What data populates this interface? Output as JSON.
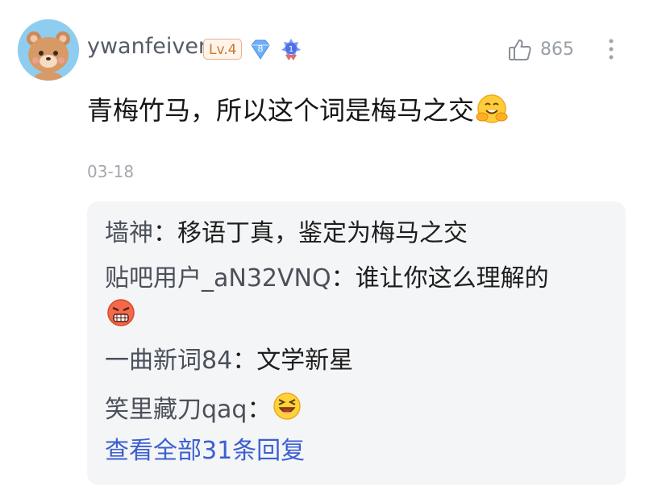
{
  "comment": {
    "username": "ywanfeiver",
    "level": "Lv.4",
    "gem_badge": "8",
    "medal_badge": "1",
    "like_count": "865",
    "text": "青梅竹马，所以这个词是梅马之交",
    "text_emoji": "hugging-face-emoji",
    "date": "03-18"
  },
  "replies": [
    {
      "user": "墙神",
      "sep": "：",
      "text": "移语丁真，鉴定为梅马之交"
    },
    {
      "user": "贴吧用户_aN32VNQ",
      "sep": "：",
      "text": "谁让你这么理解的",
      "emoji": "angry-face-emoji"
    },
    {
      "user": "一曲新词84",
      "sep": "：",
      "text": "文学新星"
    },
    {
      "user": "笑里藏刀qaq",
      "sep": "：",
      "text": "",
      "emoji": "laughing-face-emoji"
    }
  ],
  "view_all": "查看全部31条回复",
  "colors": {
    "link": "#3c5fd0",
    "level_border": "#e9b08a",
    "reply_bg": "#f4f5f7"
  }
}
